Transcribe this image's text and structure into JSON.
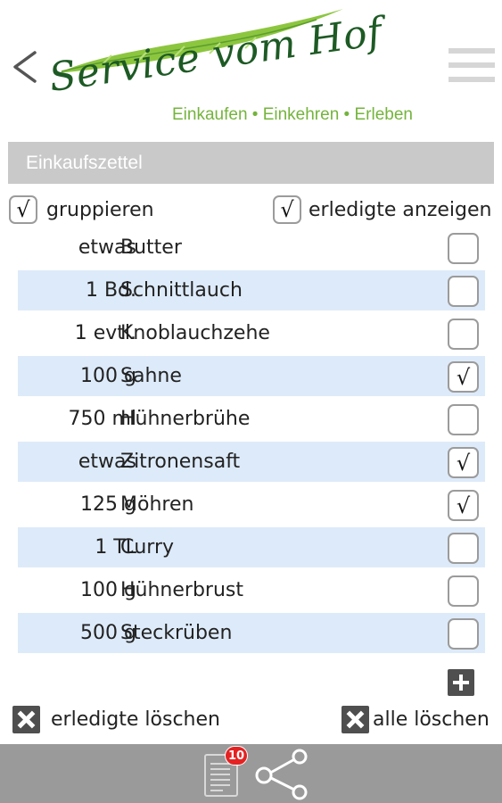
{
  "header": {
    "back_icon": "chevron-left-icon",
    "logo_title": "Service vom Hof",
    "logo_tagline": "Einkaufen • Einkehren • Erleben",
    "menu_icon": "hamburger-menu-icon"
  },
  "section": {
    "title": "Einkaufszettel"
  },
  "options": {
    "group_label": "gruppieren",
    "group_checked": "√",
    "show_done_label": "erledigte anzeigen",
    "show_done_checked": "√"
  },
  "items": [
    {
      "qty": "etwas",
      "name": "Butter",
      "check": ""
    },
    {
      "qty": "1 Bd.",
      "name": "Schnittlauch",
      "check": ""
    },
    {
      "qty": "1 evtl.",
      "name": "Knoblauchzehe",
      "check": ""
    },
    {
      "qty": "100 g",
      "name": "Sahne",
      "check": "√"
    },
    {
      "qty": "750 ml",
      "name": "Hühnerbrühe",
      "check": ""
    },
    {
      "qty": "etwas",
      "name": "Zitronensaft",
      "check": "√"
    },
    {
      "qty": "125 g",
      "name": "Möhren",
      "check": "√"
    },
    {
      "qty": "1 TL",
      "name": "Curry",
      "check": ""
    },
    {
      "qty": "100 g",
      "name": "Hühnerbrust",
      "check": ""
    },
    {
      "qty": "500 g",
      "name": "Steckrüben",
      "check": ""
    }
  ],
  "actions": {
    "add_icon": "plus-icon",
    "delete_done_label": "erledigte löschen",
    "delete_all_label": "alle löschen"
  },
  "footer": {
    "list_icon": "shopping-list-icon",
    "badge_count": "10",
    "share_icon": "share-icon"
  },
  "colors": {
    "logo_green_dark": "#1d5a24",
    "logo_green_light": "#74b43c",
    "section_bar": "#c9c9c9",
    "row_alt": "#ddeaf9",
    "footer": "#9a9a9a",
    "badge": "#e42222"
  }
}
